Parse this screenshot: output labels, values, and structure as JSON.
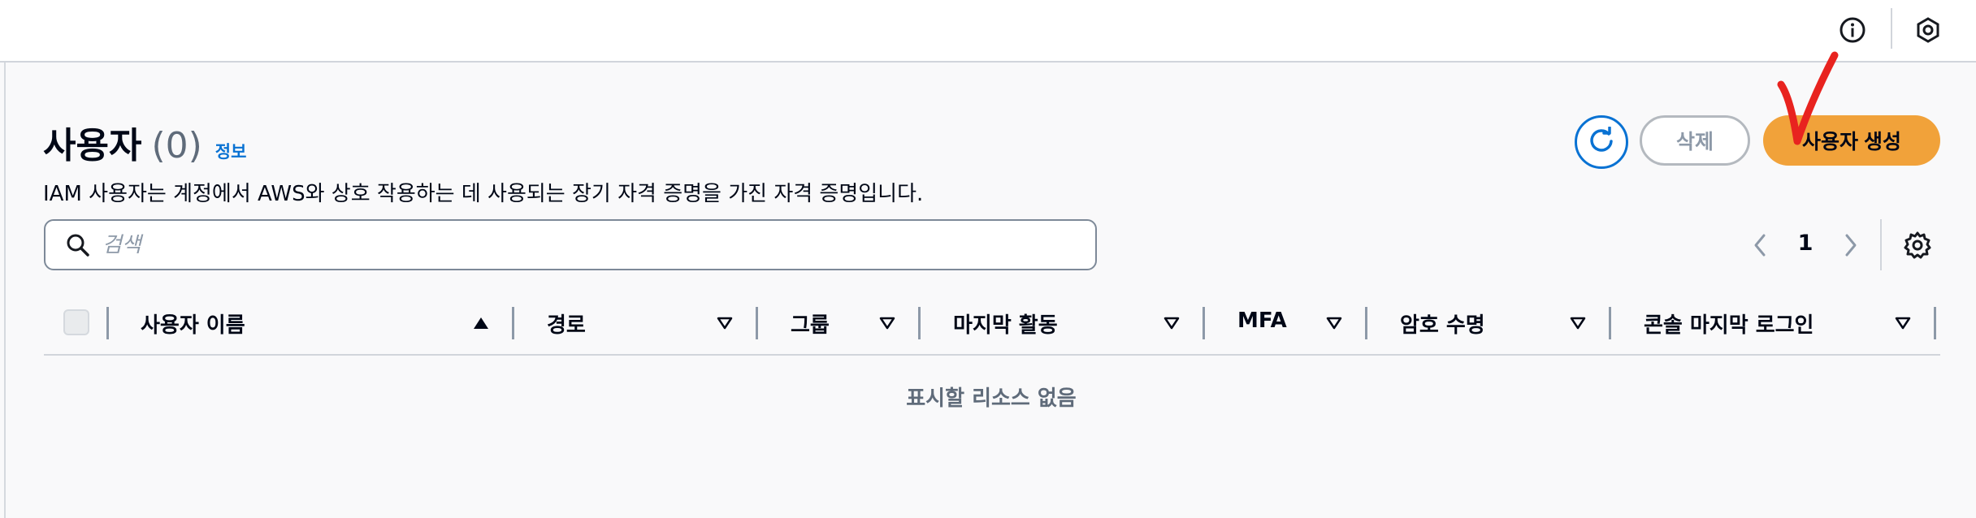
{
  "page": {
    "title": "사용자",
    "count": "(0)",
    "info_link": "정보",
    "description": "IAM 사용자는 계정에서 AWS와 상호 작용하는 데 사용되는 장기 자격 증명을 가진 자격 증명입니다."
  },
  "actions": {
    "refresh_icon": "refresh-icon",
    "delete_label": "삭제",
    "create_label": "사용자 생성"
  },
  "topbar": {
    "icons": [
      "info-circle-icon",
      "settings-hex-icon"
    ]
  },
  "search": {
    "placeholder": "검색",
    "value": ""
  },
  "pagination": {
    "current_page": "1"
  },
  "table": {
    "columns": [
      {
        "label": "사용자 이름",
        "sort": "ascending"
      },
      {
        "label": "경로",
        "sort": "none"
      },
      {
        "label": "그룹",
        "sort": "none"
      },
      {
        "label": "마지막 활동",
        "sort": "none"
      },
      {
        "label": "MFA",
        "sort": "none"
      },
      {
        "label": "암호 수명",
        "sort": "none"
      },
      {
        "label": "콘솔 마지막 로그인",
        "sort": "none"
      }
    ],
    "empty_message": "표시할 리소스 없음"
  },
  "colors": {
    "primary_button": "#f1a23a",
    "link": "#0972d3",
    "annotation_checkmark": "#e8231f"
  }
}
